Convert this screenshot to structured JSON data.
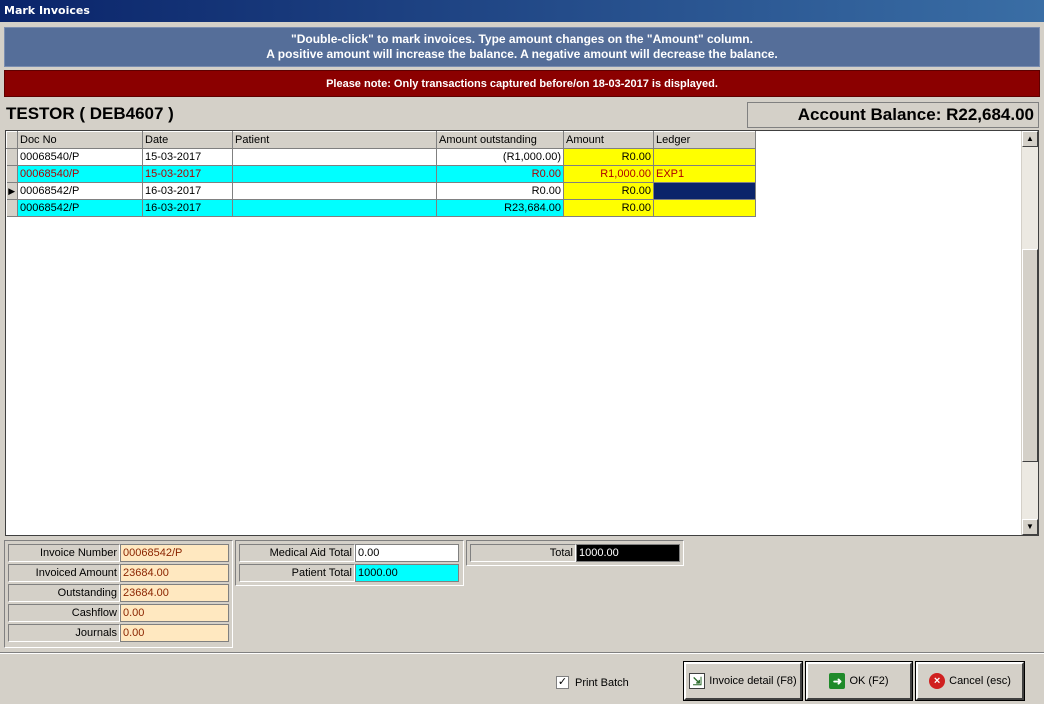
{
  "window": {
    "title": "Mark Invoices"
  },
  "info": {
    "line1": "\"Double-click\" to mark invoices.  Type amount changes on the \"Amount\" column.",
    "line2": "A positive amount will increase the balance.  A negative amount will decrease the balance."
  },
  "notice": "Please note: Only transactions captured before/on 18-03-2017 is displayed.",
  "client": "TESTOR ( DEB4607 )",
  "account_balance": "Account Balance: R22,684.00",
  "grid": {
    "columns": [
      "Doc No",
      "Date",
      "Patient",
      "Amount outstanding",
      "Amount",
      "Ledger"
    ],
    "rows": [
      {
        "doc": "00068540/P",
        "date": "15-03-2017",
        "patient": "",
        "outstanding": "(R1,000.00)",
        "amount": "R0.00",
        "ledger": ""
      },
      {
        "doc": "00068540/P",
        "date": "15-03-2017",
        "patient": "",
        "outstanding": "R0.00",
        "amount": "R1,000.00",
        "ledger": "EXP1"
      },
      {
        "doc": "00068542/P",
        "date": "16-03-2017",
        "patient": "",
        "outstanding": "R0.00",
        "amount": "R0.00",
        "ledger": ""
      },
      {
        "doc": "00068542/P",
        "date": "16-03-2017",
        "patient": "",
        "outstanding": "R23,684.00",
        "amount": "R0.00",
        "ledger": ""
      }
    ]
  },
  "summary": {
    "invoice_number_label": "Invoice Number",
    "invoice_number": "00068542/P",
    "invoiced_amount_label": "Invoiced Amount",
    "invoiced_amount": "23684.00",
    "outstanding_label": "Outstanding",
    "outstanding": "23684.00",
    "cashflow_label": "Cashflow",
    "cashflow": "0.00",
    "journals_label": "Journals",
    "journals": "0.00"
  },
  "totals": {
    "medical_aid_label": "Medical Aid Total",
    "medical_aid": "0.00",
    "patient_label": "Patient Total",
    "patient": "1000.00",
    "total_label": "Total",
    "total": "1000.00"
  },
  "footer": {
    "print_batch_label": "Print Batch",
    "print_batch_checked": true,
    "invoice_detail_label": "Invoice detail (F8)",
    "ok_label": "OK (F2)",
    "cancel_label": "Cancel (esc)"
  },
  "colors": {
    "title_bar": "#0a246a",
    "info_bg": "#556e99",
    "notice_bg": "#8b0000",
    "highlight_cyan": "#00ffff",
    "amount_yellow": "#ffff00",
    "summary_peach": "#ffe8c0"
  }
}
